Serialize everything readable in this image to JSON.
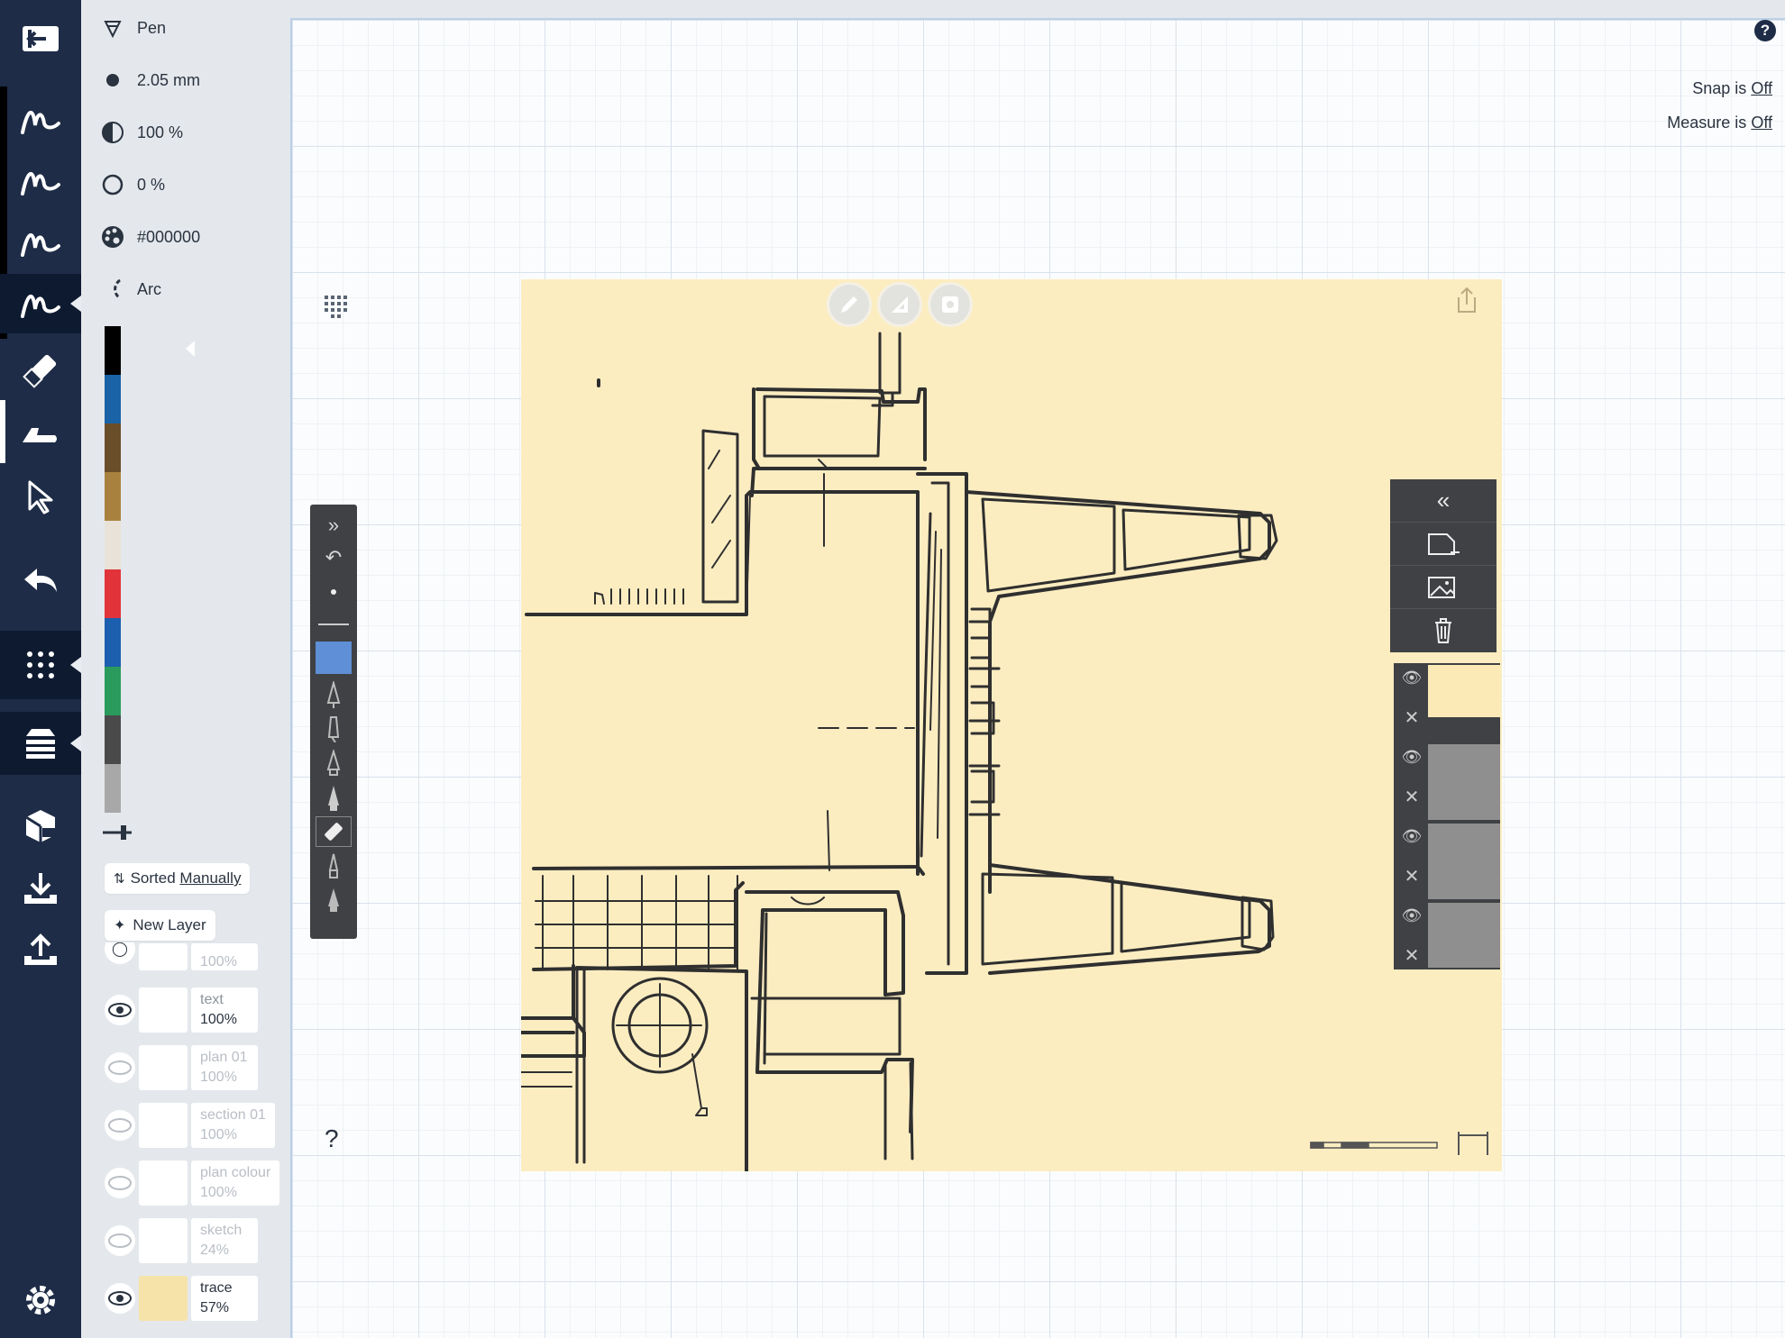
{
  "tool_panel": {
    "tool_name": "Pen",
    "size": "2.05 mm",
    "opacity": "100 %",
    "fill": "0 %",
    "color_hex": "#000000",
    "line_mode": "Arc"
  },
  "palette": [
    "#000000",
    "#1a63a6",
    "#6a4e2a",
    "#a9813f",
    "#e8e2d8",
    "#e1333a",
    "#1c5fae",
    "#2a9b5c",
    "#4a4a4a",
    "#a8a8a8"
  ],
  "layers": {
    "sort_label": "Sorted",
    "sort_value": "Manually",
    "new_layer_label": "New Layer",
    "items": [
      {
        "name": "",
        "opacity": "100%",
        "visible": false
      },
      {
        "name": "text",
        "opacity": "100%",
        "visible": true
      },
      {
        "name": "plan 01",
        "opacity": "100%",
        "visible": false
      },
      {
        "name": "section 01",
        "opacity": "100%",
        "visible": false
      },
      {
        "name": "plan colour",
        "opacity": "100%",
        "visible": false
      },
      {
        "name": "sketch",
        "opacity": "24%",
        "visible": false
      },
      {
        "name": "trace",
        "opacity": "57%",
        "visible": true
      }
    ]
  },
  "status": {
    "snap_label": "Snap is",
    "snap_value": "Off",
    "measure_label": "Measure is",
    "measure_value": "Off"
  },
  "help": "?",
  "canvas_help": "?",
  "icons": {
    "rail": [
      "exit-icon",
      "pen-1-icon",
      "pen-2-icon",
      "pen-3-icon",
      "pen-4-icon",
      "eraser-icon",
      "hand-icon",
      "select-icon",
      "undo-icon",
      "grid-icon",
      "layers-icon",
      "objects-icon",
      "import-icon",
      "export-icon",
      "settings-icon"
    ]
  }
}
